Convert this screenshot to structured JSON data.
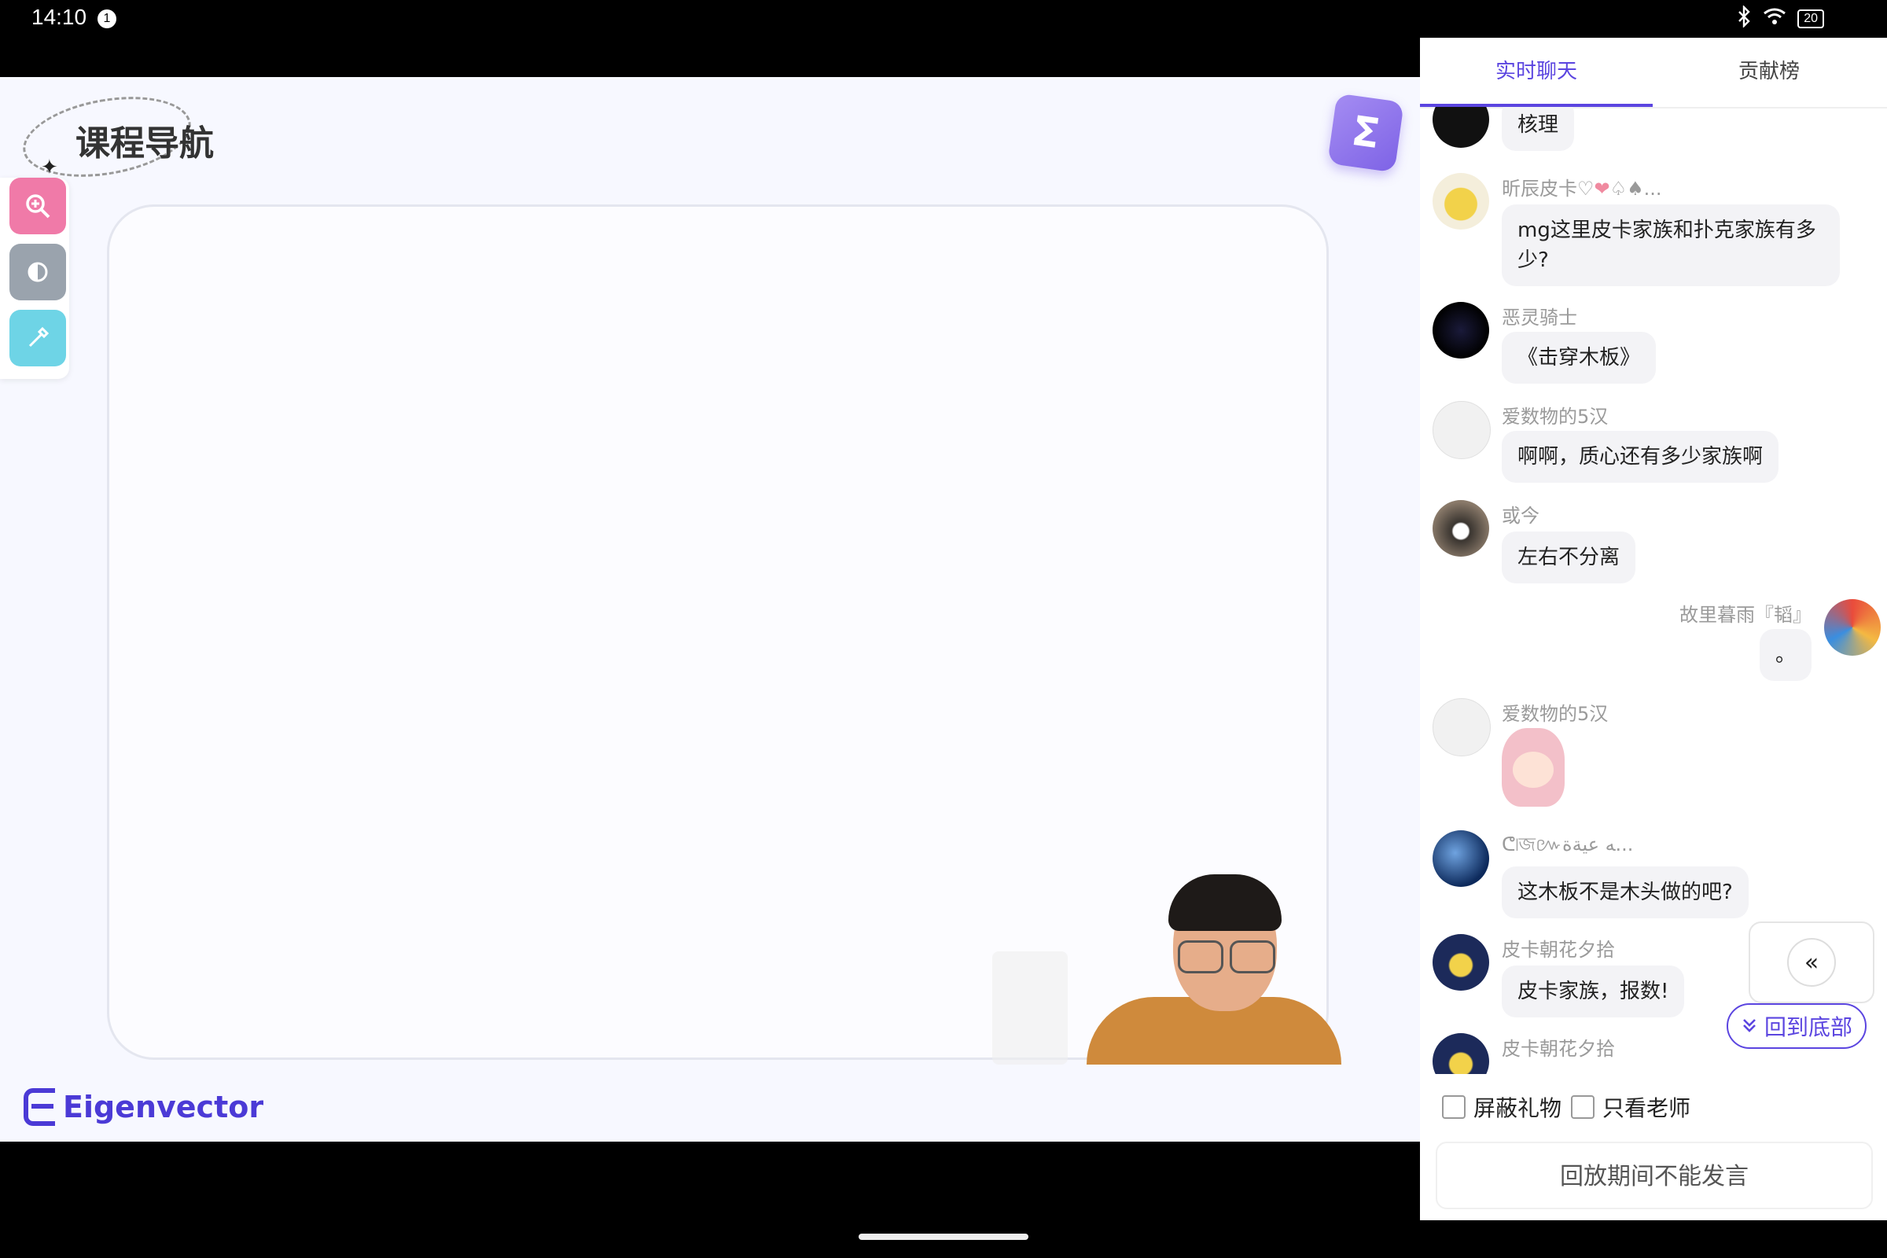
{
  "status_bar": {
    "time": "14:10",
    "notification_count": "1",
    "battery": "20"
  },
  "video": {
    "nav_title": "课程导航",
    "brand": "Eigenvector",
    "logo_glyph": "Σ",
    "tools": [
      "zoom-icon",
      "contrast-icon",
      "eyedropper-icon"
    ]
  },
  "panel": {
    "tabs": {
      "live_chat": "实时聊天",
      "leaderboard": "贡献榜"
    },
    "messages": [
      {
        "user": "",
        "text": "核理",
        "align": "left"
      },
      {
        "user": "昕辰皮卡♡",
        "user_suffix": "...",
        "text": "mg这里皮卡家族和扑克家族有多少?",
        "align": "left"
      },
      {
        "user": "恶灵骑士",
        "text": "《击穿木板》",
        "align": "left"
      },
      {
        "user": "爱数物的5汉",
        "text": "啊啊，质心还有多少家族啊",
        "align": "left"
      },
      {
        "user": "或今",
        "text": "左右不分离",
        "align": "left"
      },
      {
        "user": "故里暮雨『韬』",
        "text": "。",
        "align": "right"
      },
      {
        "user": "爱数物的5汉",
        "text": "",
        "sticker": "anime-girl-sticker",
        "align": "left"
      },
      {
        "user": "ᕦ৷জ៚ﻪ عيةة...",
        "text": "这木板不是木头做的吧?",
        "align": "left"
      },
      {
        "user": "皮卡朝花夕拾",
        "text": "皮卡家族，报数!",
        "align": "left"
      },
      {
        "user": "皮卡朝花夕拾",
        "text": "",
        "align": "left"
      }
    ],
    "back_to_bottom": "回到底部",
    "options": {
      "block_gifts": "屏蔽礼物",
      "teacher_only": "只看老师"
    },
    "input_disabled": "回放期间不能发言"
  },
  "colors": {
    "accent": "#5b45e0",
    "tool_pink": "#f07aa8",
    "tool_gray": "#9aa3ad",
    "tool_cyan": "#6ed4e6"
  }
}
